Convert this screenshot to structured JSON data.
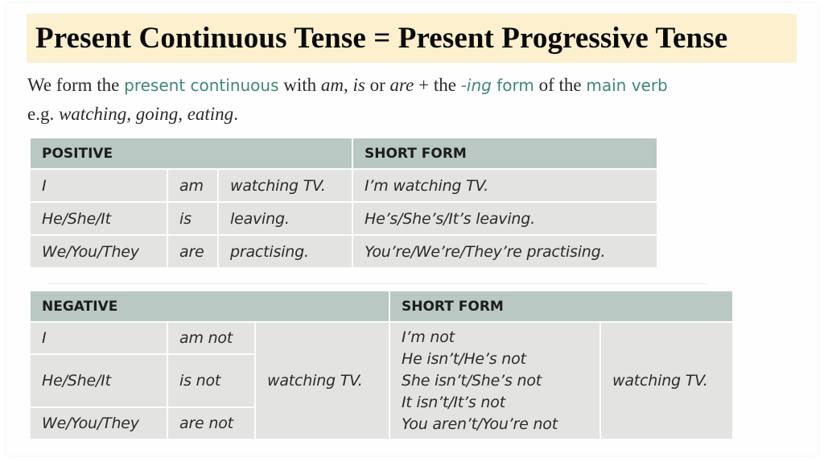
{
  "title": "Present Continuous Tense = Present Progressive Tense",
  "intro": {
    "line1": [
      {
        "text": "We form the ",
        "style": "normal"
      },
      {
        "text": "present continuous",
        "style": "green"
      },
      {
        "text": " with ",
        "style": "normal"
      },
      {
        "text": "am",
        "style": "italic"
      },
      {
        "text": ", ",
        "style": "normal"
      },
      {
        "text": "is",
        "style": "italic"
      },
      {
        "text": " or ",
        "style": "normal"
      },
      {
        "text": "are",
        "style": "italic"
      },
      {
        "text": " + the ",
        "style": "normal"
      },
      {
        "text": "-ing",
        "style": "green-italic"
      },
      {
        "text": " form",
        "style": "green"
      },
      {
        "text": " of the ",
        "style": "normal"
      },
      {
        "text": "main verb",
        "style": "green"
      }
    ],
    "line2_prefix": "e.g. ",
    "line2_examples": "watching, going, eating",
    "line2_suffix": "."
  },
  "positive_table": {
    "header": "POSITIVE",
    "short_header": "SHORT FORM",
    "rows": [
      {
        "subject": "I",
        "verb": "am",
        "rest": "watching TV.",
        "short": "I’m watching TV."
      },
      {
        "subject": "He/She/It",
        "verb": "is",
        "rest": "leaving.",
        "short": "He’s/She’s/It’s leaving."
      },
      {
        "subject": "We/You/They",
        "verb": "are",
        "rest": "practising.",
        "short": "You’re/We’re/They’re practising."
      }
    ]
  },
  "negative_table": {
    "header": "NEGATIVE",
    "short_header": "SHORT FORM",
    "rows": [
      {
        "subject": "I",
        "verb": "am not"
      },
      {
        "subject": "He/She/It",
        "verb": "is not"
      },
      {
        "subject": "We/You/They",
        "verb": "are not"
      }
    ],
    "rest": "watching TV.",
    "short_forms": [
      "I’m not",
      "He isn’t/He’s not",
      "She isn’t/She’s not",
      "It isn’t/It’s not",
      "You aren’t/You’re not"
    ],
    "short_rest": "watching TV."
  },
  "colors": {
    "title_bg": "#fdf0cf",
    "header_bg": "#b9c8c3",
    "cell_bg": "#e3e3e1",
    "accent_green": "#3f8778"
  }
}
